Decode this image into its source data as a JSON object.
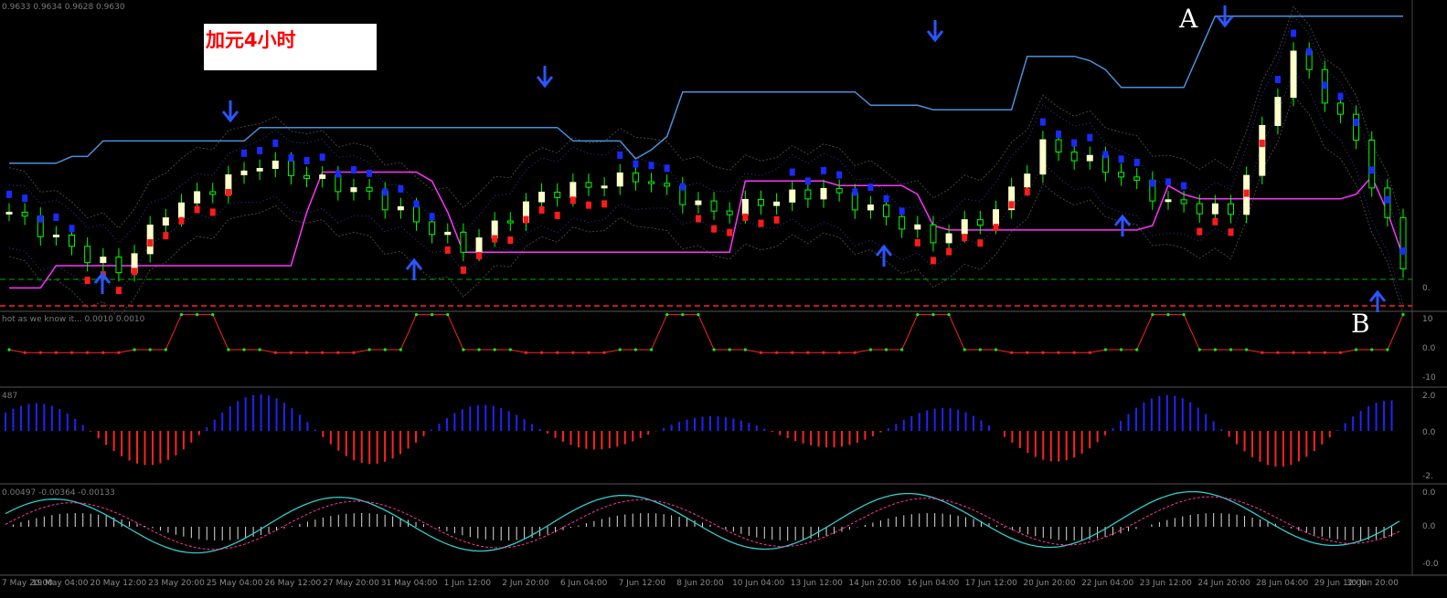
{
  "main_title": "加元4小时",
  "price_header": "0.9633 0.9634 0.9628 0.9630",
  "indicator1_header": "hot as we know it... 0.0010 0.0010",
  "indicator2_header": "487",
  "indicator3_header": "0.00497 -0.00364 -0.00133",
  "annotation_a": "A",
  "annotation_b": "B",
  "time_labels": [
    "7 May 20:00",
    "19 May 04:00",
    "20 May 12:00",
    "23 May 20:00",
    "25 May 04:00",
    "26 May 12:00",
    "27 May 20:00",
    "31 May 04:00",
    "1 Jun 12:00",
    "2 Jun 20:00",
    "6 Jun 04:00",
    "7 Jun 12:00",
    "8 Jun 20:00",
    "10 Jun 04:00",
    "13 Jun 12:00",
    "14 Jun 20:00",
    "16 Jun 04:00",
    "17 Jun 12:00",
    "20 Jun 20:00",
    "22 Jun 04:00",
    "23 Jun 12:00",
    "24 Jun 20:00",
    "28 Jun 04:00",
    "29 Jun 12:00",
    "30 Jun 20:00"
  ],
  "right_labels": {
    "p1": "0.",
    "p2_top": "10",
    "p2_mid": "0.0",
    "p2_bot": "-10",
    "p3_top": "2.0",
    "p3_mid": "0.0",
    "p3_bot": "-2.",
    "p4_top": "0.0",
    "p4_mid": "0.0",
    "p4_bot": "-0.0"
  },
  "colors": {
    "background": "#000000",
    "bull": "#ffffcc",
    "bull_wick": "#00ff00",
    "upper_band": "#4a90d9",
    "lower_band": "#ff33ff",
    "hist_pos": "#2222ff",
    "hist_neg": "#ff2222",
    "signal_cyan": "#33cccc",
    "arrow": "#2a55ff"
  },
  "chart_data": {
    "type": "candlestick",
    "series": [
      {
        "name": "upper_band",
        "values": [
          0.983,
          0.983,
          0.983,
          0.983,
          0.9845,
          0.9845,
          0.988,
          0.988,
          0.988,
          0.988,
          0.988,
          0.988,
          0.988,
          0.988,
          0.988,
          0.988,
          0.991,
          0.991,
          0.991,
          0.991,
          0.991,
          0.991,
          0.991,
          0.991,
          0.991,
          0.991,
          0.991,
          0.991,
          0.991,
          0.991,
          0.991,
          0.991,
          0.991,
          0.991,
          0.991,
          0.991,
          0.988,
          0.988,
          0.988,
          0.988,
          0.984,
          0.986,
          0.989,
          0.999,
          0.999,
          0.999,
          0.999,
          0.999,
          0.999,
          0.999,
          0.999,
          0.999,
          0.999,
          0.999,
          0.999,
          0.996,
          0.996,
          0.996,
          0.996,
          0.995,
          0.995,
          0.995,
          0.995,
          0.995,
          0.995,
          1.007,
          1.007,
          1.007,
          1.007,
          1.006,
          1.004,
          1.0,
          1.0,
          1.0,
          1.0,
          1.0,
          1.008,
          1.016,
          1.016,
          1.016,
          1.016,
          1.016,
          1.016,
          1.016,
          1.016,
          1.016,
          1.016,
          1.016,
          1.016,
          1.016
        ]
      },
      {
        "name": "lower_band",
        "values": [
          0.955,
          0.955,
          0.955,
          0.96,
          0.96,
          0.96,
          0.96,
          0.96,
          0.96,
          0.96,
          0.96,
          0.96,
          0.96,
          0.96,
          0.96,
          0.96,
          0.96,
          0.96,
          0.96,
          0.972,
          0.981,
          0.981,
          0.981,
          0.981,
          0.981,
          0.981,
          0.981,
          0.979,
          0.972,
          0.963,
          0.963,
          0.963,
          0.963,
          0.963,
          0.963,
          0.963,
          0.963,
          0.963,
          0.963,
          0.963,
          0.963,
          0.963,
          0.963,
          0.963,
          0.963,
          0.963,
          0.963,
          0.979,
          0.979,
          0.979,
          0.979,
          0.979,
          0.979,
          0.978,
          0.978,
          0.978,
          0.978,
          0.978,
          0.976,
          0.969,
          0.968,
          0.968,
          0.968,
          0.968,
          0.968,
          0.968,
          0.968,
          0.968,
          0.968,
          0.968,
          0.968,
          0.968,
          0.968,
          0.969,
          0.978,
          0.976,
          0.975,
          0.975,
          0.975,
          0.975,
          0.975,
          0.975,
          0.975,
          0.975,
          0.975,
          0.975,
          0.976,
          0.98,
          0.972,
          0.962
        ]
      }
    ]
  }
}
